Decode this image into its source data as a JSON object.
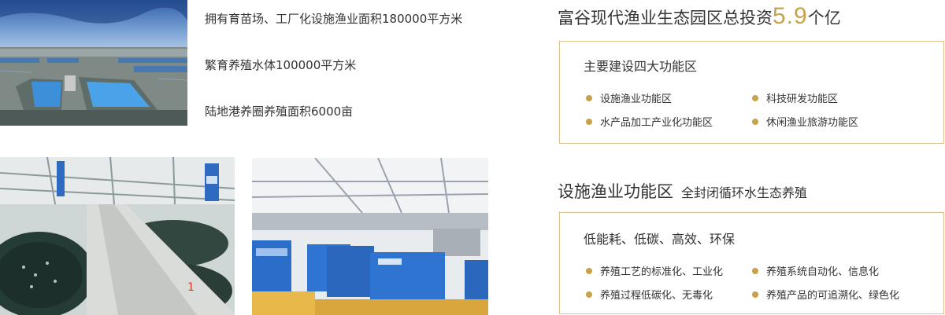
{
  "photos": {
    "aerial": "aerial-fish-farm-photo",
    "indoor_tanks": "indoor-fish-tanks-photo",
    "equipment": "blue-equipment-cabinets-photo"
  },
  "stats": [
    "拥有育苗场、工厂化设施渔业面积180000平方米",
    "繁育养殖水体100000平方米",
    "陆地港养圈养殖面积6000亩"
  ],
  "investment": {
    "prefix": "富谷现代渔业生态园区总投资",
    "amount": "5.9",
    "suffix": "个亿"
  },
  "zones": {
    "title": "主要建设四大功能区",
    "items": [
      "设施渔业功能区",
      "科技研发功能区",
      "水产品加工产业化功能区",
      "休闲渔业旅游功能区"
    ]
  },
  "facility": {
    "heading": "设施渔业功能区",
    "subheading": "全封闭循环水生态养殖",
    "box_title": "低能耗、低碳、高效、环保",
    "items": [
      "养殖工艺的标准化、工业化",
      "养殖系统自动化、信息化",
      "养殖过程低碳化、无毒化",
      "养殖产品的可追溯化、绿色化"
    ]
  },
  "colors": {
    "accent": "#c8a24a",
    "border": "#d9c28f",
    "text": "#333333"
  }
}
